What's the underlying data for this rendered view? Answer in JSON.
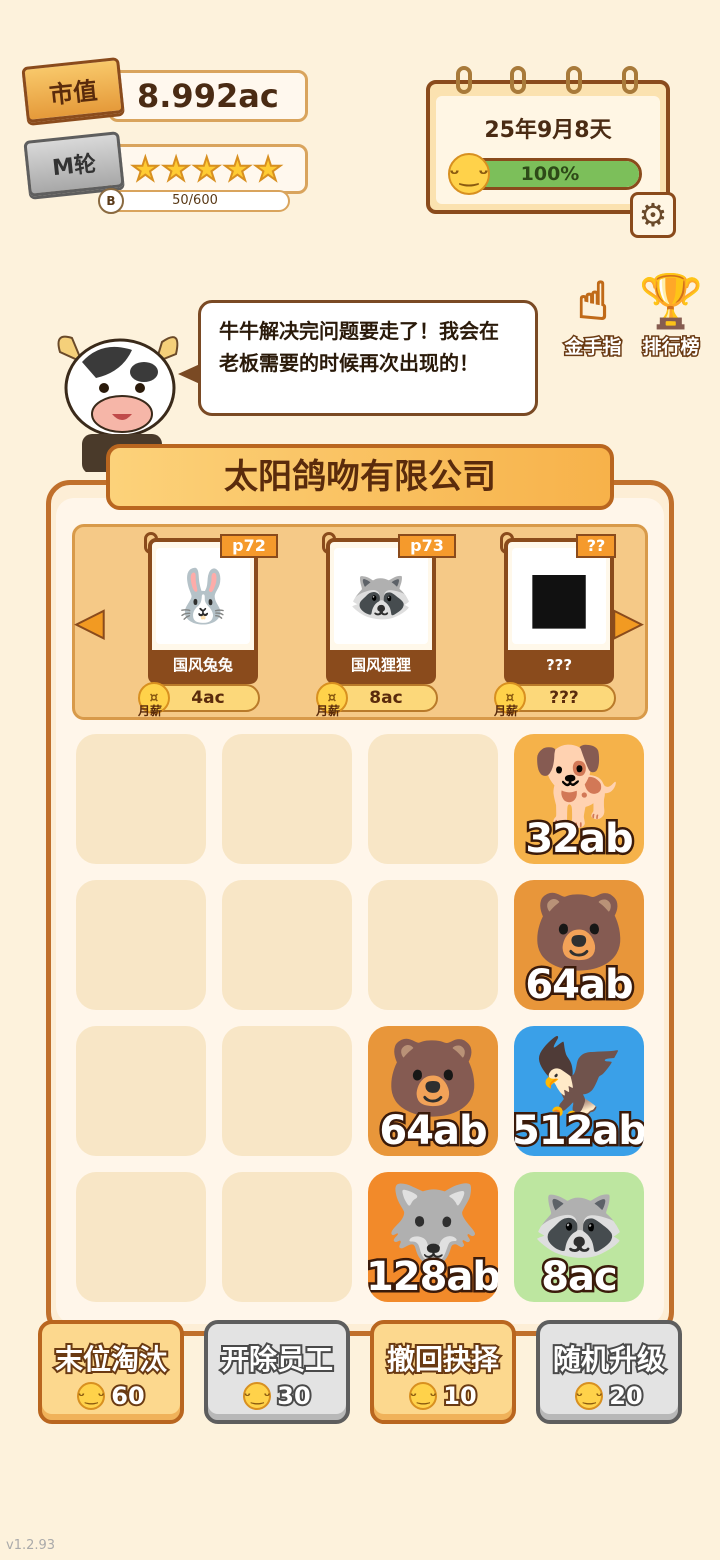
{
  "header": {
    "market_label": "市值",
    "market_value": "8.992ac",
    "round_label": "M轮",
    "stars": 5,
    "exp_badge": "B",
    "exp_text": "50/600",
    "exp_fraction": 0.083
  },
  "calendar": {
    "date": "25年9月8天",
    "mood_percent": "100%",
    "mood_fraction": 1.0,
    "settings_icon": "gear-icon"
  },
  "side_actions": [
    {
      "label": "金手指",
      "icon": "pointing-hand-icon"
    },
    {
      "label": "排行榜",
      "icon": "trophy-icon"
    }
  ],
  "dialog": {
    "text": "牛牛解决完问题要走了！我会在老板需要的时候再次出现的！"
  },
  "company": {
    "name": "太阳鸽吻有限公司"
  },
  "carousel": {
    "cards": [
      {
        "tag": "p72",
        "name": "国风兔兔",
        "salary_label": "月薪",
        "salary": "4ac",
        "icon": "🐰"
      },
      {
        "tag": "p73",
        "name": "国风狸狸",
        "salary_label": "月薪",
        "salary": "8ac",
        "icon": "🦝"
      },
      {
        "tag": "??",
        "name": "???",
        "salary_label": "月薪",
        "salary": "???",
        "icon": "locked"
      }
    ]
  },
  "grid": [
    {
      "row": 0,
      "col": 3,
      "value": "32ab",
      "icon": "🐕",
      "color": "#f5b24a"
    },
    {
      "row": 1,
      "col": 3,
      "value": "64ab",
      "icon": "🐻",
      "color": "#e8963a"
    },
    {
      "row": 2,
      "col": 2,
      "value": "64ab",
      "icon": "🐻",
      "color": "#e8963a"
    },
    {
      "row": 2,
      "col": 3,
      "value": "512ab",
      "icon": "🦅",
      "color": "#3aa0e8"
    },
    {
      "row": 3,
      "col": 2,
      "value": "128ab",
      "icon": "🐺",
      "color": "#f28a2a"
    },
    {
      "row": 3,
      "col": 3,
      "value": "8ac",
      "icon": "🦝",
      "color": "#bde6a0"
    }
  ],
  "buttons": [
    {
      "label": "末位淘汰",
      "cost": "60",
      "style": "orange"
    },
    {
      "label": "开除员工",
      "cost": "30",
      "style": "grey"
    },
    {
      "label": "撤回抉择",
      "cost": "10",
      "style": "orange"
    },
    {
      "label": "随机升级",
      "cost": "20",
      "style": "grey"
    }
  ],
  "version": "v1.2.93"
}
